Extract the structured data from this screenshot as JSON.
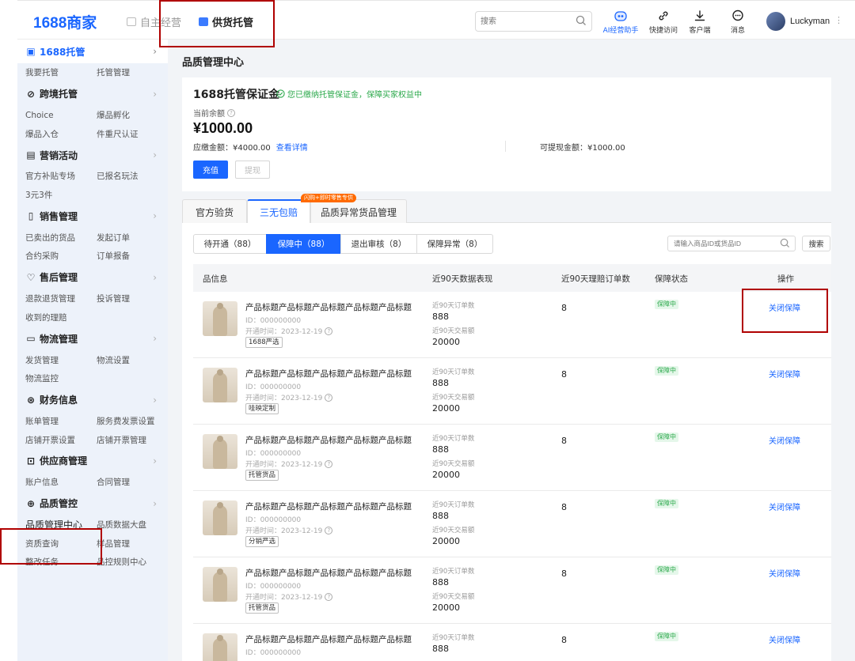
{
  "topbar": {
    "logo_num": "1688",
    "logo_text": "商家",
    "nav": [
      "自主经营",
      "供货托管"
    ],
    "search_placeholder": "搜索",
    "tools": [
      {
        "label": "AI经营助手",
        "icon": "robot-icon"
      },
      {
        "label": "快捷访问",
        "icon": "link-icon"
      },
      {
        "label": "客户端",
        "icon": "download-icon"
      },
      {
        "label": "消息",
        "icon": "message-icon"
      }
    ],
    "username": "Luckyman"
  },
  "sidebar": [
    {
      "title": "1688托管",
      "icon": "shield-icon",
      "active": true,
      "items": [
        [
          "我要托管",
          "托管管理"
        ]
      ]
    },
    {
      "title": "跨境托管",
      "icon": "globe-icon",
      "items": [
        [
          "Choice",
          "爆品孵化"
        ],
        [
          "爆品入仓",
          "件重尺认证"
        ]
      ]
    },
    {
      "title": "营销活动",
      "icon": "gift-icon",
      "items": [
        [
          "官方补贴专场",
          "已报名玩法"
        ],
        [
          "3元3件",
          ""
        ]
      ]
    },
    {
      "title": "销售管理",
      "icon": "document-icon",
      "items": [
        [
          "已卖出的货品",
          "发起订单"
        ],
        [
          "合约采购",
          "订单报备"
        ]
      ]
    },
    {
      "title": "售后管理",
      "icon": "heart-icon",
      "items": [
        [
          "退款退货管理",
          "投诉管理"
        ],
        [
          "收到的理赔",
          ""
        ]
      ]
    },
    {
      "title": "物流管理",
      "icon": "truck-icon",
      "items": [
        [
          "发货管理",
          "物流设置"
        ],
        [
          "物流监控",
          ""
        ]
      ]
    },
    {
      "title": "财务信息",
      "icon": "yen-icon",
      "items": [
        [
          "账单管理",
          "服务费发票设置"
        ],
        [
          "店铺开票设置",
          "店铺开票管理"
        ]
      ]
    },
    {
      "title": "供应商管理",
      "icon": "building-icon",
      "items": [
        [
          "账户信息",
          "合同管理"
        ]
      ]
    },
    {
      "title": "品质管控",
      "icon": "check-icon",
      "items": [
        [
          "品质管理中心",
          "品质数据大盘"
        ],
        [
          "资质查询",
          "样品管理"
        ],
        [
          "整改任务",
          "品控规则中心"
        ]
      ]
    }
  ],
  "main": {
    "page_title": "品质管理中心",
    "deposit": {
      "title": "1688托管保证金",
      "status": "您已缴纳托管保证金，保障买家权益中",
      "balance_label": "当前余额",
      "balance": "¥1000.00",
      "due": "应缴金额：¥4000.00",
      "detail_link": "查看详情",
      "withdrawable": "可提现金额：¥1000.00",
      "recharge_btn": "充值",
      "withdraw_btn": "提现"
    },
    "tabs": [
      "官方验货",
      "三无包赔",
      "品质异常货品管理"
    ],
    "tab_badge": "闪购+即时零售专供",
    "subtabs": [
      "待开通（88）",
      "保障中（88）",
      "退出审核（8）",
      "保障异常（8）"
    ],
    "search_placeholder": "请输入商品ID或货品ID",
    "search_btn": "搜索",
    "table": {
      "headers": [
        "品信息",
        "近90天数据表现",
        "近90天理赔订单数",
        "保障状态",
        "操作"
      ],
      "rows": [
        {
          "title": "产品标题产品标题产品标题产品标题产品标题",
          "id": "ID：000000000",
          "time": "开通时间：2023-12-19",
          "tag": "1688严选",
          "orders_label": "近90天订单数",
          "orders": "888",
          "gmv_label": "近90天交易额",
          "gmv": "20000",
          "claims": "8",
          "status": "保障中",
          "action": "关闭保障"
        },
        {
          "title": "产品标题产品标题产品标题产品标题产品标题",
          "id": "ID：000000000",
          "time": "开通时间：2023-12-19",
          "tag": "哇映定制",
          "orders_label": "近90天订单数",
          "orders": "888",
          "gmv_label": "近90天交易额",
          "gmv": "20000",
          "claims": "8",
          "status": "保障中",
          "action": "关闭保障"
        },
        {
          "title": "产品标题产品标题产品标题产品标题产品标题",
          "id": "ID：000000000",
          "time": "开通时间：2023-12-19",
          "tag": "托管货品",
          "orders_label": "近90天订单数",
          "orders": "888",
          "gmv_label": "近90天交易额",
          "gmv": "20000",
          "claims": "8",
          "status": "保障中",
          "action": "关闭保障"
        },
        {
          "title": "产品标题产品标题产品标题产品标题产品标题",
          "id": "ID：000000000",
          "time": "开通时间：2023-12-19",
          "tag": "分销严选",
          "orders_label": "近90天订单数",
          "orders": "888",
          "gmv_label": "近90天交易额",
          "gmv": "20000",
          "claims": "8",
          "status": "保障中",
          "action": "关闭保障"
        },
        {
          "title": "产品标题产品标题产品标题产品标题产品标题",
          "id": "ID：000000000",
          "time": "开通时间：2023-12-19",
          "tag": "托管货品",
          "orders_label": "近90天订单数",
          "orders": "888",
          "gmv_label": "近90天交易额",
          "gmv": "20000",
          "claims": "8",
          "status": "保障中",
          "action": "关闭保障"
        },
        {
          "title": "产品标题产品标题产品标题产品标题产品标题",
          "id": "ID：000000000",
          "time": "",
          "tag": "",
          "orders_label": "近90天订单数",
          "orders": "888",
          "gmv_label": "",
          "gmv": "",
          "claims": "8",
          "status": "保障中",
          "action": "关闭保障"
        }
      ]
    }
  },
  "colors": {
    "brand": "#1a66ff",
    "success": "#2aa84a",
    "annotation": "#b00000",
    "badge": "#ff6a00"
  }
}
